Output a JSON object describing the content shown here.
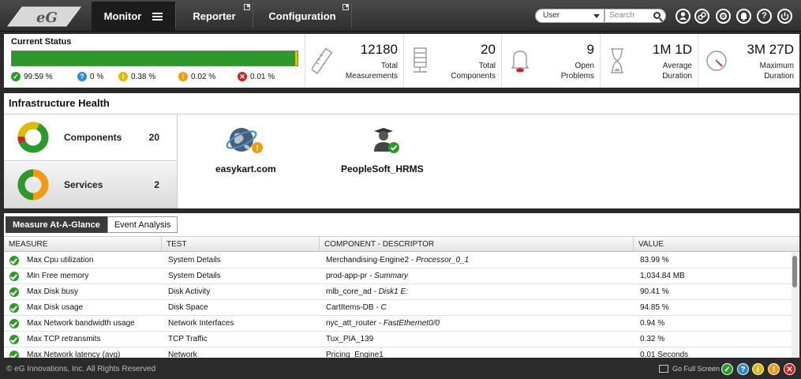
{
  "nav": {
    "logo_text": "eG",
    "tabs": [
      {
        "label": "Monitor"
      },
      {
        "label": "Reporter"
      },
      {
        "label": "Configuration"
      }
    ],
    "user_select_value": "User",
    "search_placeholder": "Search",
    "icons": [
      "user-icon",
      "link-icon",
      "gear-icon",
      "bell-icon",
      "help-icon",
      "power-icon"
    ]
  },
  "current_status": {
    "title": "Current Status",
    "bar_fill_fraction": 0.9959,
    "legend": [
      {
        "value": "99.59 %",
        "color": "#2a9b2a"
      },
      {
        "value": "0 %",
        "color": "#2a8ad6"
      },
      {
        "value": "0.38 %",
        "color": "#e0bc00"
      },
      {
        "value": "0.02 %",
        "color": "#f39a10"
      },
      {
        "value": "0.01 %",
        "color": "#d02020"
      }
    ]
  },
  "metrics": [
    {
      "value": "12180",
      "label1": "Total",
      "label2": "Measurements",
      "icon": "ruler-icon"
    },
    {
      "value": "20",
      "label1": "Total",
      "label2": "Components",
      "icon": "server-icon"
    },
    {
      "value": "9",
      "label1": "Open",
      "label2": "Problems",
      "icon": "alarm-bell-icon"
    },
    {
      "value": "1M 1D",
      "label1": "Average",
      "label2": "Duration",
      "icon": "hourglass-icon"
    },
    {
      "value": "3M 27D",
      "label1": "Maximum",
      "label2": "Duration",
      "icon": "gauge-icon"
    }
  ],
  "infra": {
    "title": "Infrastructure Health",
    "items": [
      {
        "label": "Components",
        "count": "20"
      },
      {
        "label": "Services",
        "count": "2"
      }
    ],
    "services": [
      {
        "name": "easykart.com",
        "status": "warning"
      },
      {
        "name": "PeopleSoft_HRMS",
        "status": "ok"
      }
    ]
  },
  "measures": {
    "tabs": [
      "Measure At-A-Glance",
      "Event Analysis"
    ],
    "headers": [
      "MEASURE",
      "TEST",
      "COMPONENT - DESCRIPTOR",
      "VALUE"
    ],
    "rows": [
      {
        "measure": "Max Cpu utilization",
        "test": "System Details",
        "component": "Merchandising-Engine2",
        "descriptor": "Processor_0_1",
        "value": "83.99 %"
      },
      {
        "measure": "Min Free memory",
        "test": "System Details",
        "component": "prod-app-pr",
        "descriptor": "Summary",
        "value": "1,034.84 MB"
      },
      {
        "measure": "Max Disk busy",
        "test": "Disk Activity",
        "component": "mlb_core_ad",
        "descriptor": "Disk1 E:",
        "value": "90.41 %"
      },
      {
        "measure": "Max Disk usage",
        "test": "Disk Space",
        "component": "CartItems-DB",
        "descriptor": "C",
        "value": "94.85 %"
      },
      {
        "measure": "Max Network bandwidth usage",
        "test": "Network Interfaces",
        "component": "nyc_att_router",
        "descriptor": "FastEthernet0/0",
        "value": "0.94 %"
      },
      {
        "measure": "Max TCP retransmits",
        "test": "TCP Traffic",
        "component": "Tux_PIA_139",
        "descriptor": "",
        "value": "0.32 %"
      },
      {
        "measure": "Max Network latency (avg)",
        "test": "Network",
        "component": "Pricing_Engine1",
        "descriptor": "",
        "value": "0.01 Seconds"
      }
    ]
  },
  "footer": {
    "copyright": "© eG Innovations, Inc. All Rights Reserved",
    "fullscreen_label": "Go Full Screen"
  }
}
